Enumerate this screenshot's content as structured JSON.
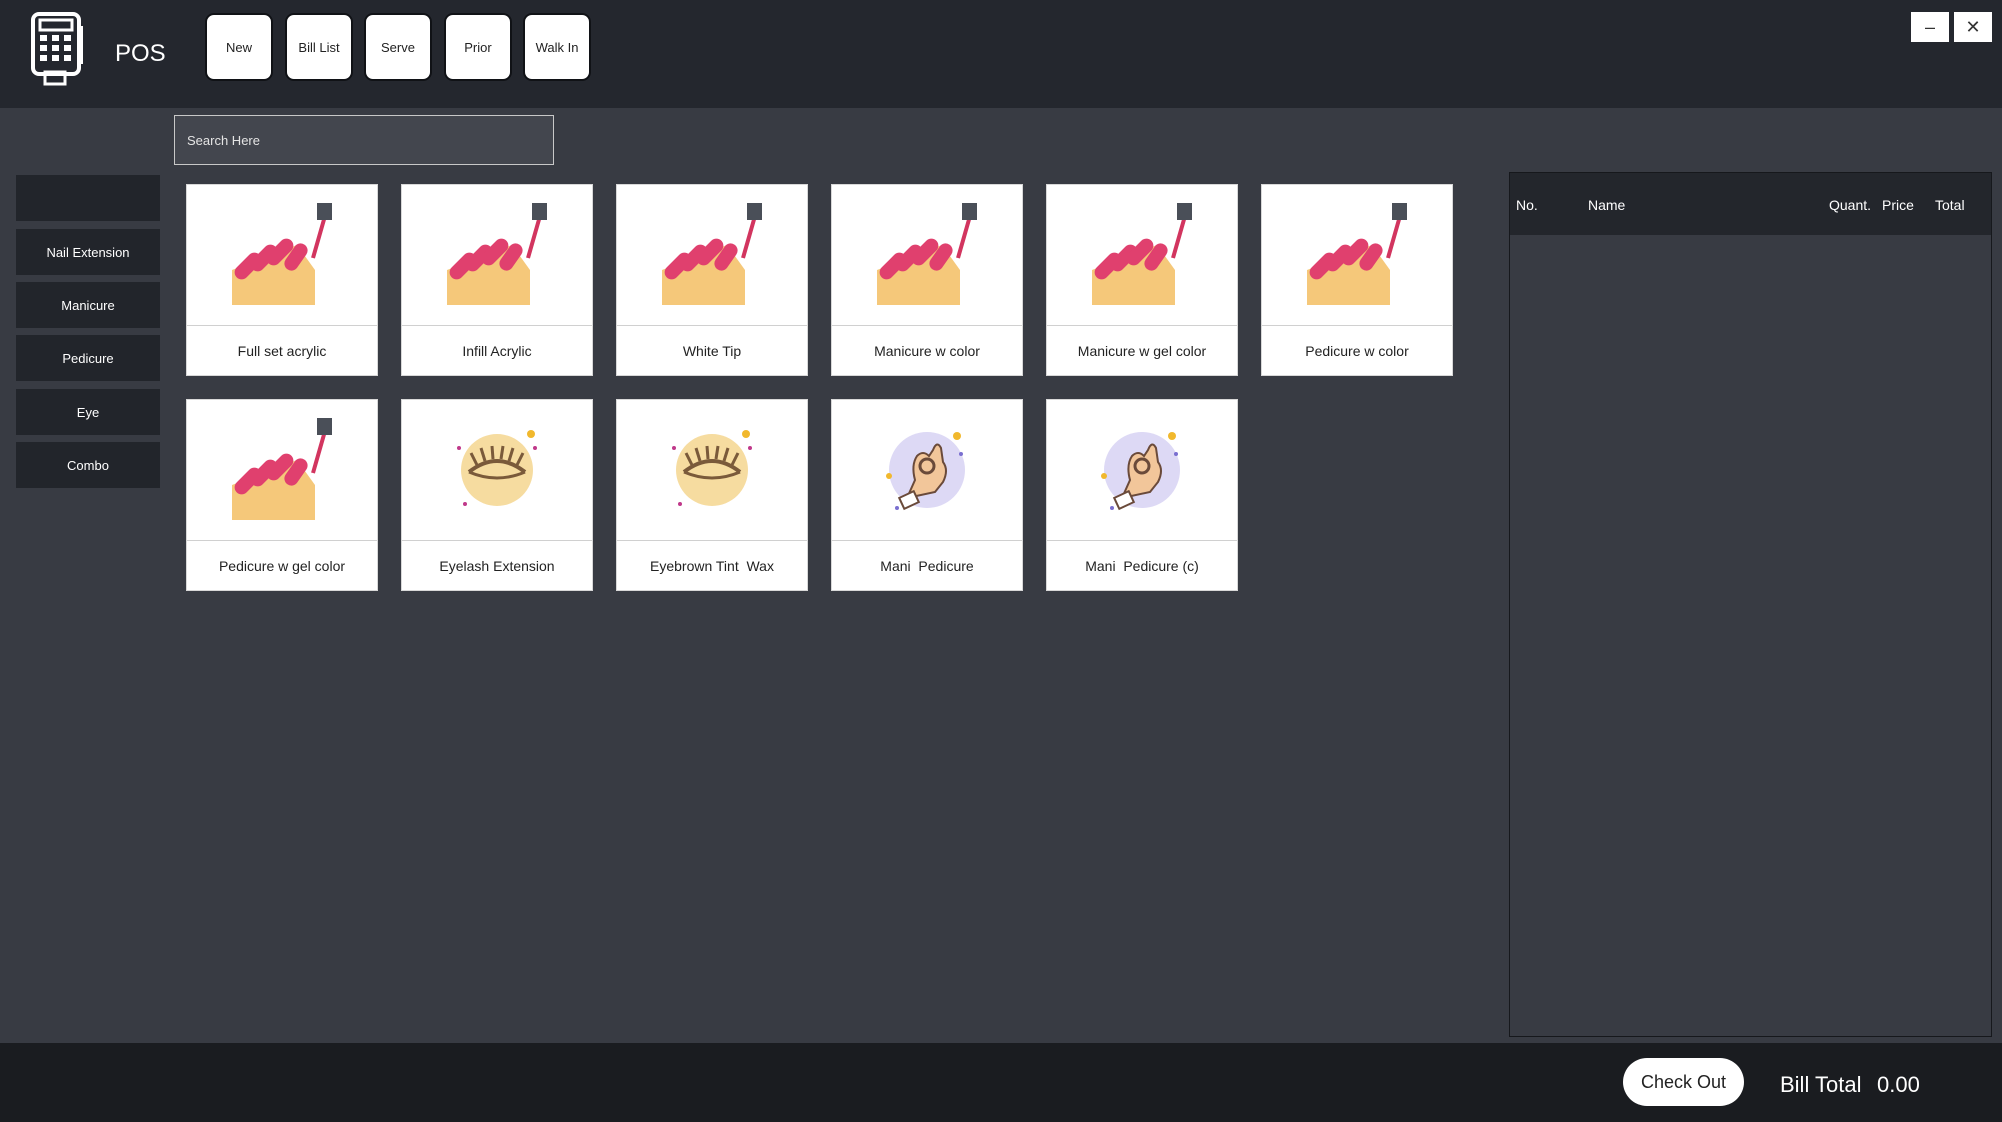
{
  "app": {
    "title": "POS",
    "logo_icon": "pos-terminal-icon"
  },
  "toolbar": {
    "new": "New",
    "bill_list": "Bill List",
    "serve": "Serve",
    "prior": "Prior",
    "walk_in": "Walk In"
  },
  "window": {
    "minimize": "–",
    "close": "✕"
  },
  "search": {
    "placeholder": "Search Here"
  },
  "categories": [
    "",
    "Nail Extension",
    "Manicure",
    "Pedicure",
    "Eye",
    "Combo"
  ],
  "services": [
    {
      "label": "Full set acrylic",
      "icon": "nail-polish-icon"
    },
    {
      "label": "Infill Acrylic",
      "icon": "nail-polish-icon"
    },
    {
      "label": "White Tip",
      "icon": "nail-polish-icon"
    },
    {
      "label": "Manicure w color",
      "icon": "nail-polish-icon"
    },
    {
      "label": "Manicure w gel color",
      "icon": "nail-polish-icon"
    },
    {
      "label": "Pedicure w color",
      "icon": "nail-polish-icon"
    },
    {
      "label": "Pedicure w gel color",
      "icon": "nail-polish-icon"
    },
    {
      "label": "Eyelash Extension",
      "icon": "eyelash-icon"
    },
    {
      "label": "Eyebrown Tint  Wax",
      "icon": "eyelash-icon"
    },
    {
      "label": "Mani  Pedicure",
      "icon": "ok-hand-icon"
    },
    {
      "label": "Mani  Pedicure (c)",
      "icon": "ok-hand-icon"
    }
  ],
  "bill": {
    "columns": {
      "no": "No.",
      "name": "Name",
      "quant": "Quant.",
      "price": "Price",
      "total": "Total"
    }
  },
  "footer": {
    "checkout": "Check Out",
    "bill_total_label": "Bill Total",
    "bill_total_value": "0.00"
  },
  "colors": {
    "background": "#383b43",
    "topbar": "#24272e",
    "category_bg": "#22252b",
    "footer": "#1a1c20",
    "nail_polish": "#e0406e",
    "skin": "#f5c87a"
  }
}
